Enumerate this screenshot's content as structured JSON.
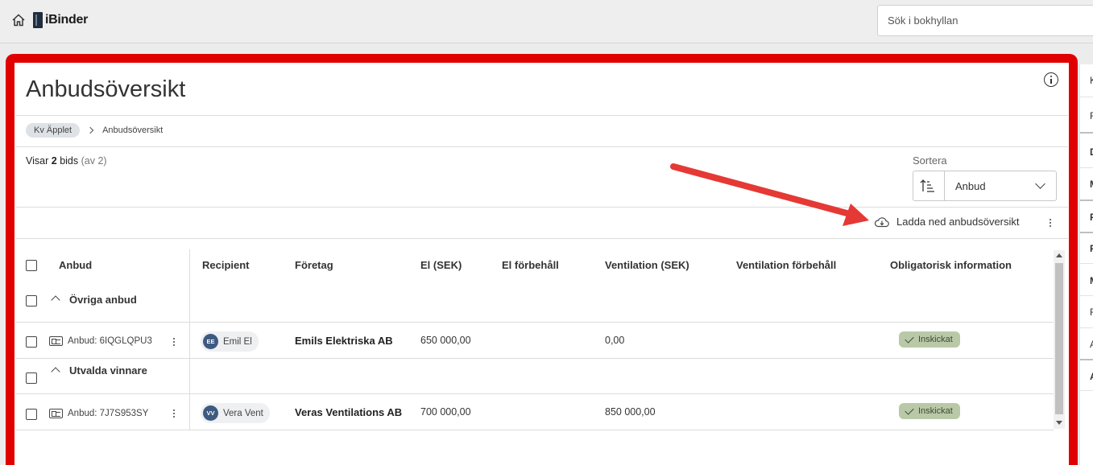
{
  "app": {
    "name": "iBinder"
  },
  "search": {
    "placeholder": "Sök i bokhyllan"
  },
  "page": {
    "title": "Anbudsöversikt"
  },
  "breadcrumb": {
    "items": [
      "Kv Äpplet",
      "Anbudsöversikt"
    ]
  },
  "results": {
    "prefix": "Visar",
    "count": "2",
    "unit": "bids",
    "total": "(av 2)"
  },
  "sort": {
    "label": "Sortera",
    "value": "Anbud"
  },
  "download": {
    "label": "Ladda ned anbudsöversikt"
  },
  "table": {
    "headers": {
      "anbud": "Anbud",
      "recipient": "Recipient",
      "foretag": "Företag",
      "el": "El (SEK)",
      "el_forbehall": "El förbehåll",
      "ventilation": "Ventilation (SEK)",
      "ventilation_forbehall": "Ventilation förbehåll",
      "obligatorisk": "Obligatorisk information"
    },
    "groups": [
      {
        "label": "Övriga anbud",
        "rows": [
          {
            "bid": "Anbud: 6IQGLQPU3",
            "initials": "EE",
            "recipient": "Emil El",
            "company": "Emils Elektriska AB",
            "el": "650 000,00",
            "el_forbehall": "",
            "ventilation": "0,00",
            "ventilation_forbehall": "",
            "status": "Inskickat"
          }
        ]
      },
      {
        "label": "Utvalda vinnare",
        "rows": [
          {
            "bid": "Anbud: 7J7S953SY",
            "initials": "VV",
            "recipient": "Vera Vent",
            "company": "Veras Ventilations AB",
            "el": "700 000,00",
            "el_forbehall": "",
            "ventilation": "850 000,00",
            "ventilation_forbehall": "",
            "status": "Inskickat"
          }
        ]
      }
    ]
  },
  "side_panel": {
    "letters": [
      "K",
      "R",
      "D",
      "M",
      "F",
      "F",
      "M",
      "F",
      "A",
      "A"
    ]
  },
  "colors": {
    "highlight": "#e00000",
    "annotation_arrow": "#e53935",
    "status_bg": "#b9c9a8",
    "avatar": "#3d5a80"
  },
  "icons": [
    "home-icon",
    "ibinder-logo",
    "info-icon",
    "chevron-right-icon",
    "sort-ascending-icon",
    "chevron-down-icon",
    "cloud-download-icon",
    "kebab-menu-icon",
    "chevron-up-icon",
    "id-card-icon",
    "checkmark-icon"
  ]
}
